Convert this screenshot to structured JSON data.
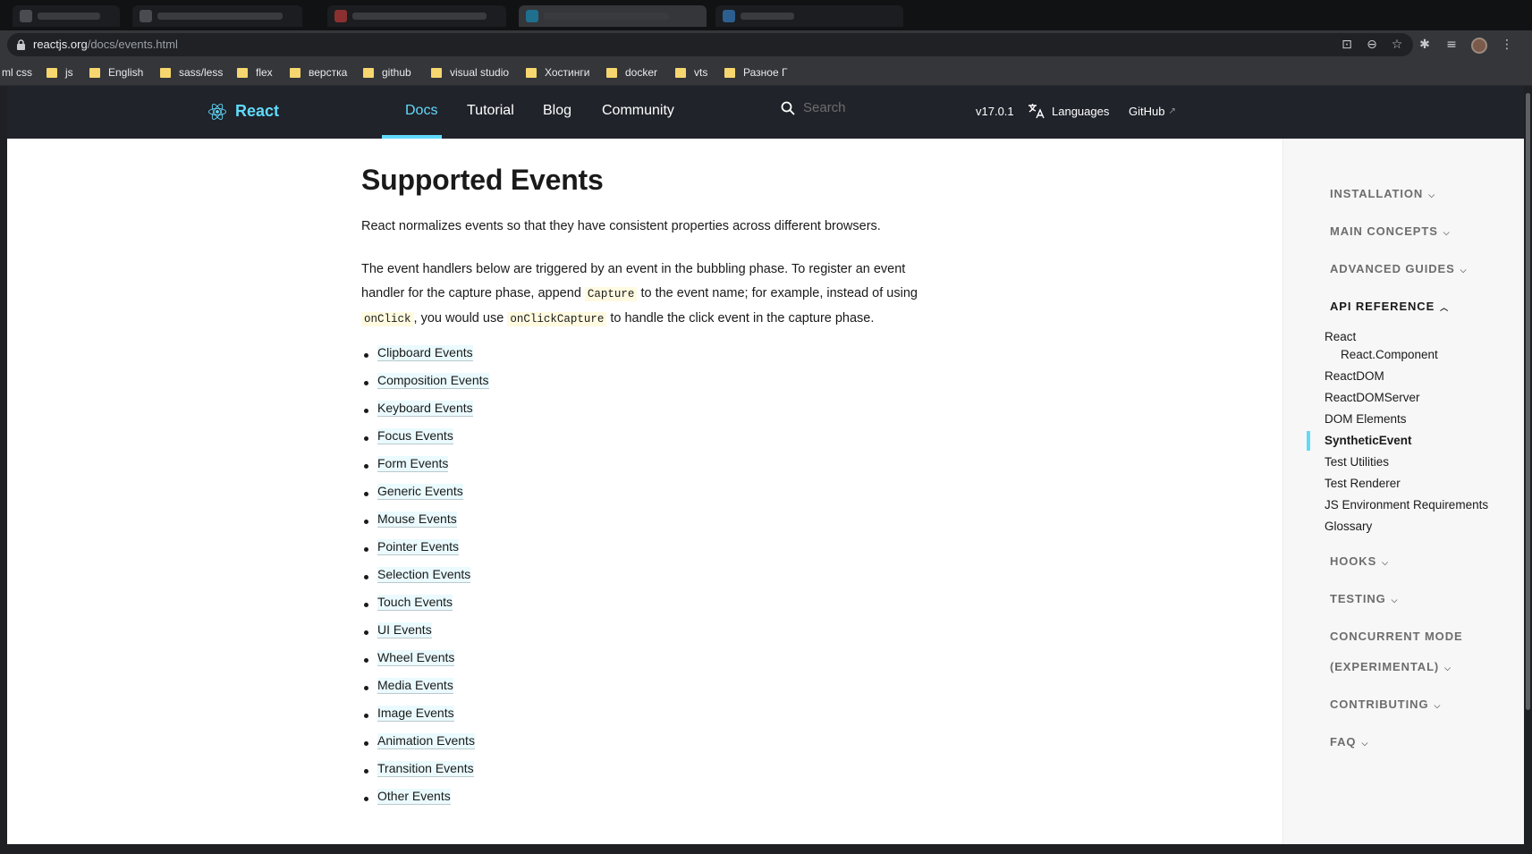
{
  "browser": {
    "url_host": "reactjs.org",
    "url_path": "/docs/events.html",
    "bookmarks": [
      "ml css",
      "js",
      "English",
      "sass/less",
      "flex",
      "верстка",
      "github",
      "visual studio",
      "Хостинги",
      "docker",
      "vts",
      "Разное Г"
    ]
  },
  "nav": {
    "brand": "React",
    "links": [
      "Docs",
      "Tutorial",
      "Blog",
      "Community"
    ],
    "search_placeholder": "Search",
    "version": "v17.0.1",
    "languages": "Languages",
    "github": "GitHub",
    "accent_color": "#61dafb"
  },
  "main": {
    "title": "Supported Events",
    "intro": "React normalizes events so that they have consistent properties across different browsers.",
    "p2_a": "The event handlers below are triggered by an event in the bubbling phase. To register an event handler for the capture phase, append ",
    "p2_code1": "Capture",
    "p2_b": " to the event name; for example, instead of using ",
    "p2_code2": "onClick",
    "p2_c": ", you would use ",
    "p2_code3": "onClickCapture",
    "p2_d": " to handle the click event in the capture phase.",
    "events": [
      "Clipboard Events",
      "Composition Events",
      "Keyboard Events",
      "Focus Events",
      "Form Events",
      "Generic Events",
      "Mouse Events",
      "Pointer Events",
      "Selection Events",
      "Touch Events",
      "UI Events",
      "Wheel Events",
      "Media Events",
      "Image Events",
      "Animation Events",
      "Transition Events",
      "Other Events"
    ]
  },
  "sidebar": {
    "sections": {
      "installation": "INSTALLATION",
      "main_concepts": "MAIN CONCEPTS",
      "advanced_guides": "ADVANCED GUIDES",
      "api_reference": "API REFERENCE",
      "hooks": "HOOKS",
      "testing": "TESTING",
      "concurrent_1": "CONCURRENT MODE",
      "concurrent_2": "(EXPERIMENTAL)",
      "contributing": "CONTRIBUTING",
      "faq": "FAQ"
    },
    "api_items": [
      "React",
      "React.Component",
      "ReactDOM",
      "ReactDOMServer",
      "DOM Elements",
      "SyntheticEvent",
      "Test Utilities",
      "Test Renderer",
      "JS Environment Requirements",
      "Glossary"
    ],
    "active_item": "SyntheticEvent"
  }
}
